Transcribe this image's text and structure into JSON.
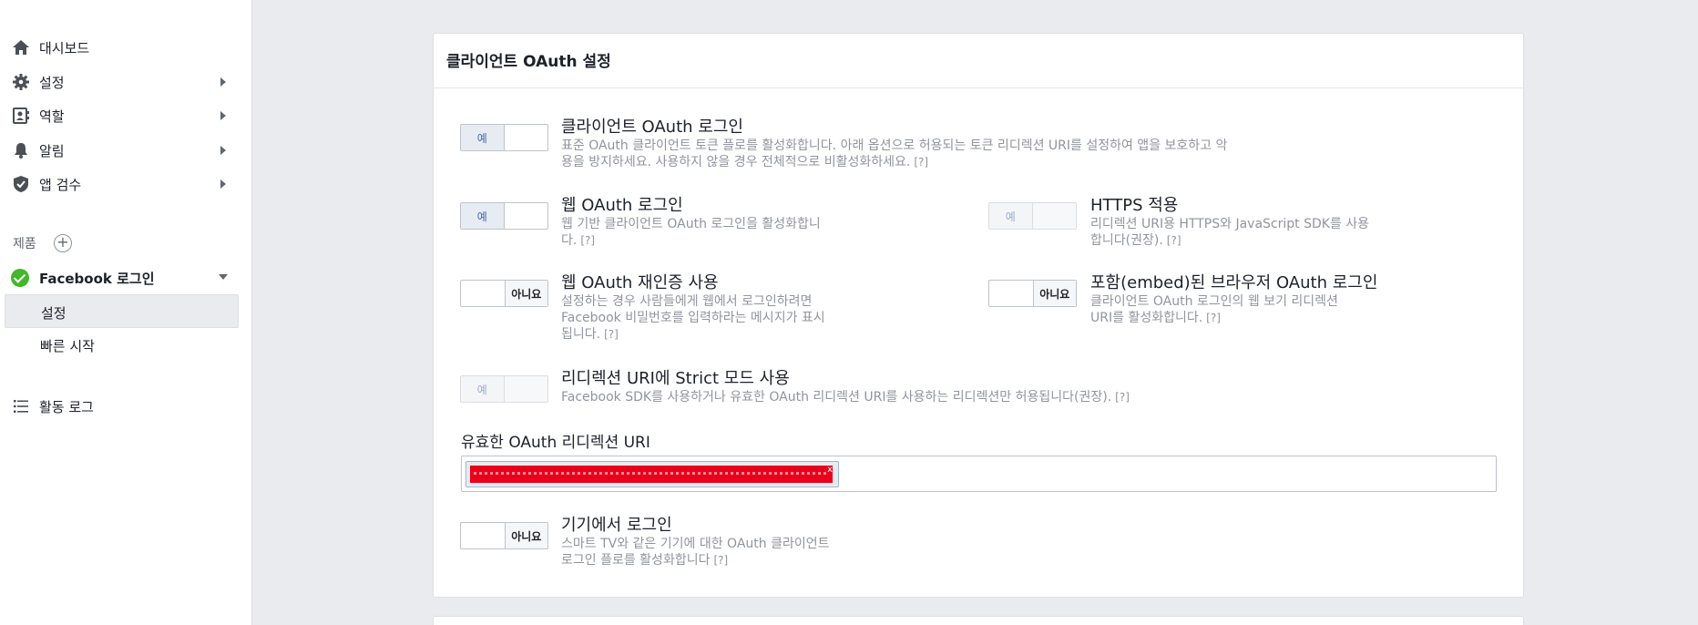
{
  "sidebar": {
    "items": [
      {
        "label": "대시보드",
        "icon": "home-icon"
      },
      {
        "label": "설정",
        "icon": "gear-icon"
      },
      {
        "label": "역할",
        "icon": "role-icon"
      },
      {
        "label": "알림",
        "icon": "bell-icon"
      },
      {
        "label": "앱 검수",
        "icon": "shield-check-icon"
      }
    ],
    "products_title": "제품",
    "product": {
      "label": "Facebook 로그인",
      "sub_items": [
        "설정",
        "빠른 시작"
      ]
    },
    "activity_log": "활동 로그"
  },
  "card": {
    "title": "클라이언트 OAuth 설정",
    "options": {
      "client_oauth": {
        "title": "클라이언트 OAuth 로그인",
        "desc": "표준 OAuth 클라이언트 토큰 플로를 활성화합니다. 아래 옵션으로 허용되는 토큰 리디렉션 URI를 설정하여 앱을 보호하고 악용을 방지하세요. 사용하지 않을 경우 전체적으로 비활성화하세요.",
        "toggle": "예"
      },
      "web_oauth": {
        "title": "웹 OAuth 로그인",
        "desc": "웹 기반 클라이언트 OAuth 로그인을 활성화합니다.",
        "toggle": "예"
      },
      "https": {
        "title": "HTTPS 적용",
        "desc": "리디렉션 URI용 HTTPS와 JavaScript SDK를 사용합니다(권장).",
        "toggle": "예"
      },
      "reauth": {
        "title": "웹 OAuth 재인증 사용",
        "desc": "설정하는 경우 사람들에게 웹에서 로그인하려면 Facebook 비밀번호를 입력하라는 메시지가 표시됩니다.",
        "toggle": "아니요"
      },
      "embedded": {
        "title": "포함(embed)된 브라우저 OAuth 로그인",
        "desc": "클라이언트 OAuth 로그인의 웹 보기 리디렉션 URI를 활성화합니다.",
        "toggle": "아니요"
      },
      "strict": {
        "title": "리디렉션 URI에 Strict 모드 사용",
        "desc": "Facebook SDK를 사용하거나 유효한 OAuth 리디렉션 URI를 사용하는 리디렉션만 허용됩니다(권장).",
        "toggle": "예"
      },
      "device": {
        "title": "기기에서 로그인",
        "desc": "스마트 TV와 같은 기기에 대한 OAuth 클라이언트 로그인 플로를 활성화합니다",
        "toggle": "아니요"
      }
    },
    "qmark": "[?]",
    "uri_label": "유효한 OAuth 리디렉션 URI",
    "uri_remove": "x"
  },
  "colors": {
    "accent": "#4267b2",
    "success": "#42b72a",
    "redaction": "#e8001c",
    "page_bg": "#e9ebee"
  }
}
